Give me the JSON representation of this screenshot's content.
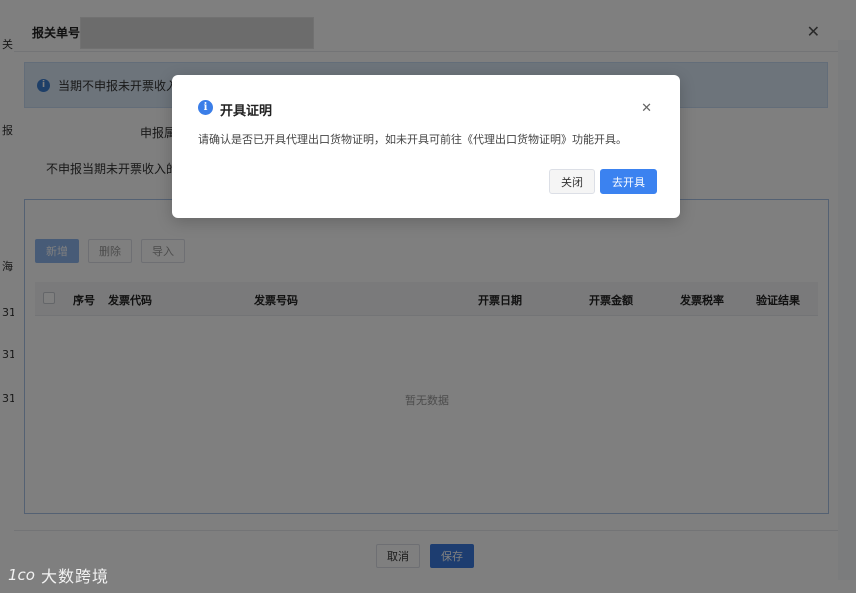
{
  "main_dialog": {
    "title_label": "报关单号:",
    "info_banner": "当期不申报未开票收入原",
    "form": {
      "label1": "申报属",
      "label2": "不申报当期未开票收入的理"
    },
    "table_panel": {
      "title": "",
      "buttons": {
        "add": "新增",
        "delete": "删除",
        "import": "导入"
      },
      "columns": [
        "序号",
        "发票代码",
        "发票号码",
        "开票日期",
        "开票金额",
        "发票税率",
        "验证结果"
      ],
      "empty_text": "暂无数据"
    },
    "footer": {
      "cancel": "取消",
      "save": "保存"
    }
  },
  "background": {
    "left_edge": [
      "关",
      "报",
      "海",
      "31",
      "31",
      "31"
    ]
  },
  "confirm_dialog": {
    "title": "开具证明",
    "message": "请确认是否已开具代理出口货物证明，如未开具可前往《代理出口货物证明》功能开具。",
    "cancel_label": "关闭",
    "confirm_label": "去开具"
  },
  "watermark": {
    "text": "大数跨境",
    "mark": "1ᴄᴏ"
  },
  "icons": {
    "info": "info-icon",
    "close": "close-icon",
    "checkbox": "checkbox-icon"
  },
  "colors": {
    "primary": "#3b82f0",
    "banner_bg": "#dbe8f7",
    "overlay": "rgba(0,0,0,0.5)"
  }
}
